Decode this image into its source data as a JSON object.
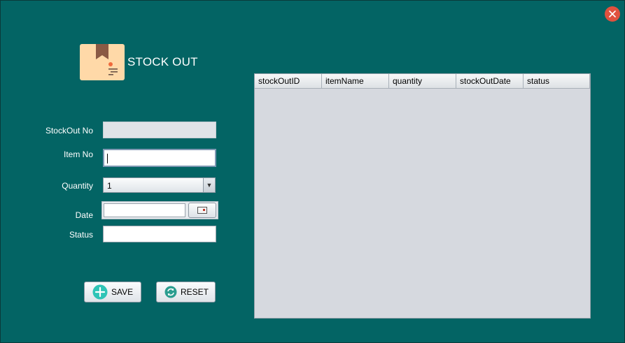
{
  "window": {
    "close_icon": "close-icon"
  },
  "header": {
    "title": "STOCK OUT",
    "logo_icon": "package-icon"
  },
  "form": {
    "stockout_no": {
      "label": "StockOut No",
      "value": ""
    },
    "item_no": {
      "label": "Item No",
      "value": ""
    },
    "quantity": {
      "label": "Quantity",
      "selected": "1"
    },
    "date": {
      "label": "Date",
      "value": "",
      "calendar_icon": "calendar-icon"
    },
    "status": {
      "label": "Status",
      "value": ""
    }
  },
  "buttons": {
    "save": {
      "label": "SAVE",
      "icon": "plus-icon"
    },
    "reset": {
      "label": "RESET",
      "icon": "refresh-icon"
    }
  },
  "table": {
    "columns": [
      "stockOutID",
      "itemName",
      "quantity",
      "stockOutDate",
      "status"
    ],
    "rows": []
  },
  "colors": {
    "background": "#036464",
    "close": "#e0513e",
    "logo_bg": "#ffd9a8",
    "ribbon": "#8a5a44",
    "save_icon": "#2ec4b6",
    "reset_icon": "#2a9d8f",
    "table_bg": "#d6d9df"
  }
}
